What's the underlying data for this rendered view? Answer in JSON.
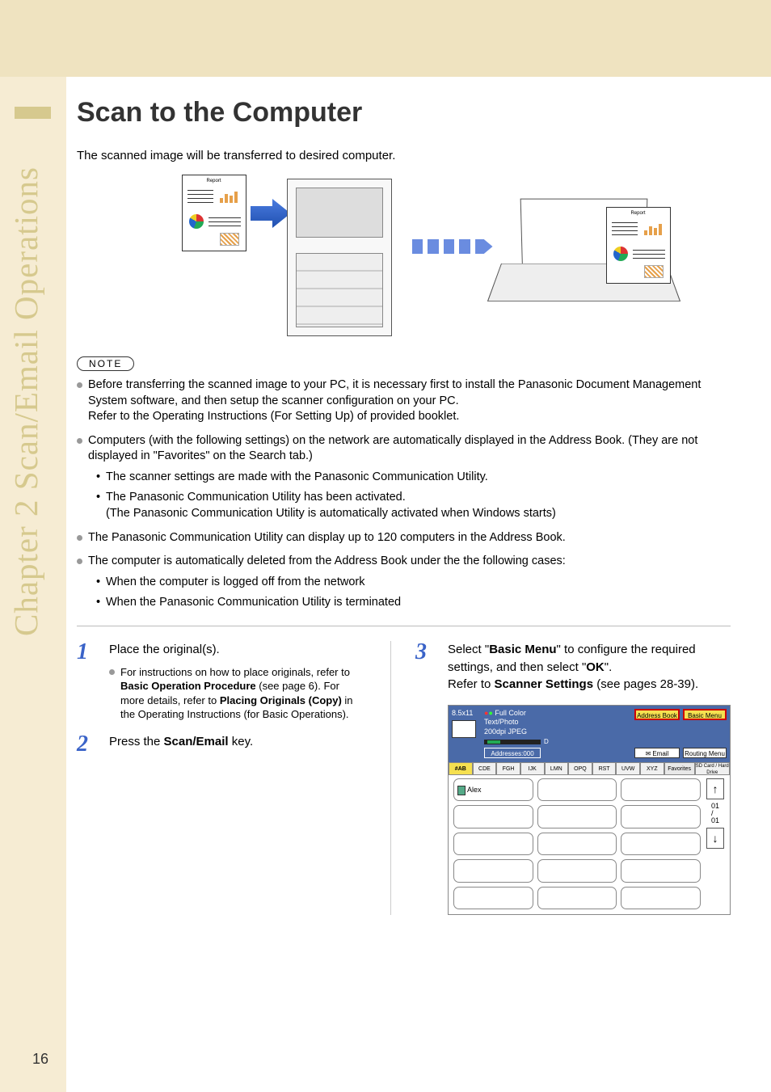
{
  "sideTab": "Chapter 2    Scan/Email Operations",
  "pageTitle": "Scan to the Computer",
  "intro": "The scanned image will be transferred to desired computer.",
  "docLabel": "Report",
  "noteLabel": "NOTE",
  "notes": {
    "n1a": "Before transferring the scanned image to your PC, it is necessary first to install the Panasonic Document Management System software, and then setup the scanner configuration on your PC.",
    "n1b": "Refer to the Operating Instructions (For Setting Up) of provided booklet.",
    "n2": "Computers (with the following settings) on the network are automatically displayed in the Address Book. (They are not displayed in \"Favorites\" on the Search tab.)",
    "n2s1": "The scanner settings are made with the Panasonic Communication Utility.",
    "n2s2a": "The Panasonic Communication Utility has been activated.",
    "n2s2b": "(The Panasonic Communication Utility is automatically activated when Windows starts)",
    "n3": "The Panasonic Communication Utility can display up to 120 computers in the Address Book.",
    "n4": "The computer is automatically deleted from the Address Book under the the following cases:",
    "n4s1": "When the computer is logged off from the network",
    "n4s2": "When the Panasonic Communication Utility is terminated"
  },
  "steps": {
    "s1": {
      "num": "1",
      "text": "Place the original(s).",
      "note_pre": "For instructions on how to place originals, refer to ",
      "note_b1": "Basic Operation Procedure",
      "note_mid1": " (see page 6). For more details, refer to ",
      "note_b2": "Placing Originals (Copy)",
      "note_post": " in the Operating Instructions (for Basic Operations)."
    },
    "s2": {
      "num": "2",
      "pre": "Press the ",
      "b": "Scan/Email",
      "post": " key."
    },
    "s3": {
      "num": "3",
      "l1_pre": "Select \"",
      "l1_b": "Basic Menu",
      "l1_post": "\" to configure the required settings, and then select \"",
      "l1_b2": "OK",
      "l1_post2": "\".",
      "l2_pre": "Refer to ",
      "l2_b": "Scanner Settings",
      "l2_post": " (see pages 28-39)."
    }
  },
  "ui": {
    "paper": "8.5x11",
    "mode": "Full Color",
    "quality": "Text/Photo",
    "res": "200dpi JPEG",
    "addresses": "Addresses:000",
    "addressBook": "Address Book",
    "basicMenu": "Basic Menu",
    "email": "Email",
    "routing": "Routing Menu",
    "tabs": [
      "#AB",
      "CDE",
      "FGH",
      "IJK",
      "LMN",
      "OPQ",
      "RST",
      "UVW",
      "XYZ",
      "Favorites",
      "SD Card / Hard Drive"
    ],
    "entry1": "Alex",
    "scroll": {
      "top": "01",
      "sep": "/",
      "bot": "01"
    }
  },
  "pageNumber": "16"
}
